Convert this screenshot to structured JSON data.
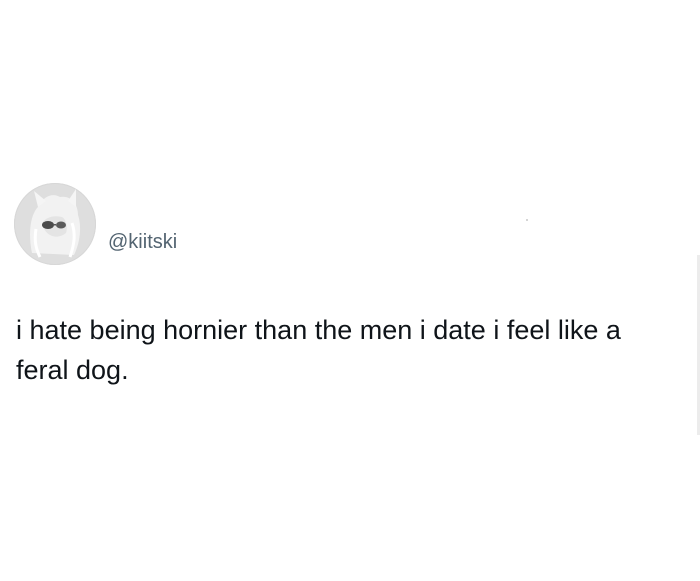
{
  "tweet": {
    "handle": "@kiitski",
    "text": "i hate being hornier than the men i date i feel like a feral dog.",
    "avatar_icon": "avatar-illustration",
    "colors": {
      "background": "#ffffff",
      "text": "#0f1419",
      "handle": "#536471"
    }
  }
}
